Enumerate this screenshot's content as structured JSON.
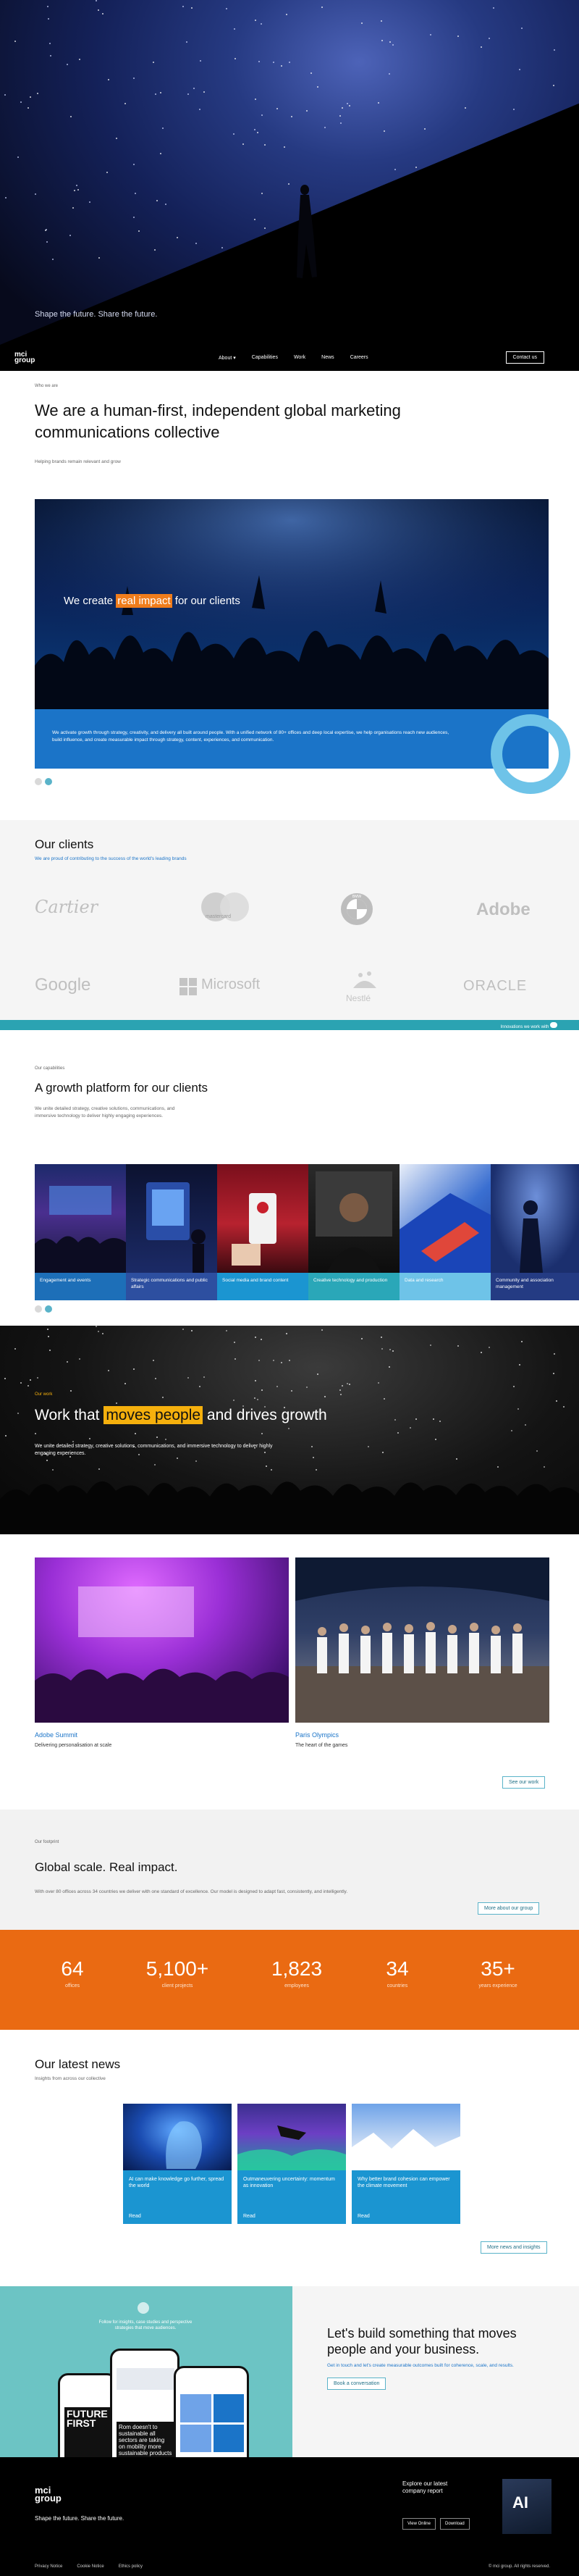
{
  "hero": {
    "tagline": "Shape the future. Share the future."
  },
  "nav": {
    "logo_top": "mci",
    "logo_bottom": "group",
    "links": [
      "About",
      "Capabilities",
      "Work",
      "News",
      "Careers"
    ],
    "about_chevron": "▾",
    "contact_label": "Contact us"
  },
  "intro": {
    "label": "Who we are",
    "heading_line1": "We are a human-first, independent global marketing",
    "heading_line2": "communications collective",
    "subtext": "Helping brands remain relevant and grow",
    "impact_pre": "We create ",
    "impact_highlight": "real impact",
    "impact_post": " for our clients",
    "impact_text": "We activate growth through strategy, creativity, and delivery all built around people. With a unified network of 80+ offices and deep local expertise, we help organisations reach new audiences, build influence, and create measurable impact through strategy, content, experiences, and communication."
  },
  "clients": {
    "title": "Our clients",
    "subtitle": "We are proud of contributing to the success of the world's leading brands",
    "logos": [
      "Cartier",
      "mastercard",
      "BMW",
      "Adobe",
      "Google",
      "Microsoft",
      "Nestlé",
      "ORACLE"
    ],
    "bar_text": "Innovations we work with"
  },
  "capabilities": {
    "label": "Our capabilities",
    "title": "A growth platform for our clients",
    "text_line1": "We unite detailed strategy, creative solutions, communications, and",
    "text_line2": "immersive technology to deliver highly engaging experiences.",
    "tiles": [
      {
        "label": "Engagement and events",
        "color": "#1d6fb8"
      },
      {
        "label": "Strategic communications and public affairs",
        "color": "#2d4fa0"
      },
      {
        "label": "Social media and brand content",
        "color": "#1b95d1"
      },
      {
        "label": "Creative technology and production",
        "color": "#2aa7b8"
      },
      {
        "label": "Data and research",
        "color": "#6ec3e8"
      },
      {
        "label": "Community and association management",
        "color": "#243b83"
      }
    ]
  },
  "work": {
    "label": "Our work",
    "heading_pre": "Work that ",
    "heading_highlight": "moves people",
    "heading_post": " and drives growth",
    "text": "We unite detailed strategy, creative solutions, communications, and immersive technology to deliver highly engaging experiences."
  },
  "cases": {
    "items": [
      {
        "title": "Adobe Summit",
        "desc": "Delivering personalisation at scale"
      },
      {
        "title": "Paris Olympics",
        "desc": "The heart of the games"
      }
    ],
    "button": "See our work"
  },
  "scale": {
    "label": "Our footprint",
    "title": "Global scale. Real impact.",
    "text": "With over 80 offices across 34 countries we deliver with one standard of excellence. Our model is designed to adapt fast, consistently, and intelligently.",
    "button": "More about our group"
  },
  "stats": [
    {
      "num": "64",
      "label": "offices"
    },
    {
      "num": "5,100+",
      "label": "client projects"
    },
    {
      "num": "1,823",
      "label": "employees"
    },
    {
      "num": "34",
      "label": "countries"
    },
    {
      "num": "35+",
      "label": "years experience"
    }
  ],
  "news": {
    "title": "Our latest news",
    "subtitle": "Insights from across our collective",
    "items": [
      {
        "title": "AI can make knowledge go further, spread the world",
        "read": "Read"
      },
      {
        "title": "Outmaneuvering uncertainty: momentum as innovation",
        "read": "Read"
      },
      {
        "title": "Why better brand cohesion can empower the climate movement",
        "read": "Read"
      }
    ],
    "button": "More news and insights"
  },
  "cta": {
    "left_text": "Follow for insights, case studies and perspective strategies that move audiences.",
    "phone_text": "Rom doesn't to sustainable all sectors are taking on mobility more sustainable products and services",
    "phone_headline": "FUTURE FIRST",
    "heading_line1": "Let's build something that moves",
    "heading_line2": "people and your business.",
    "text": "Get in touch and let's create measurable outcomes built for coherence, scale, and results.",
    "button": "Book a conversation"
  },
  "footer": {
    "logo_top": "mci",
    "logo_bottom": "group",
    "tagline": "Shape the future. Share the future.",
    "report_line1": "Explore our latest",
    "report_line2": "company report",
    "view_online": "View Online",
    "download": "Download",
    "report_badge": "AI",
    "links": [
      "Privacy Notice",
      "Cookie Notice",
      "Ethics policy"
    ],
    "copyright": "© mci group. All rights reserved."
  }
}
